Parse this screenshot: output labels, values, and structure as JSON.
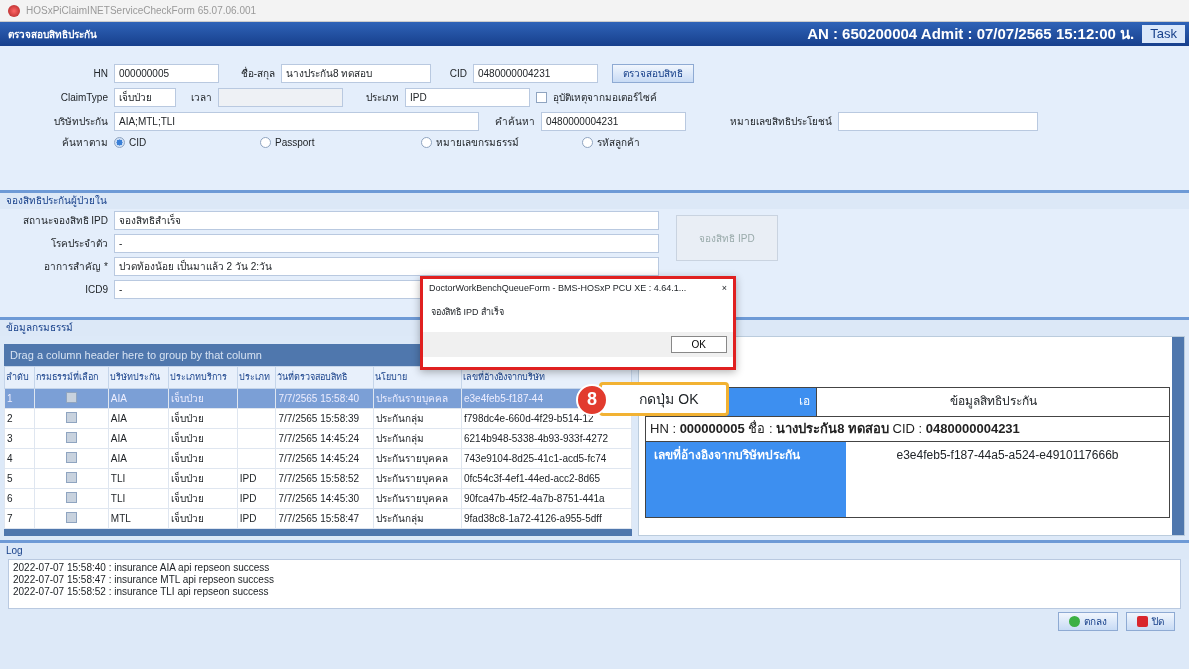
{
  "window": {
    "title": "HOSxPiClaimINETServiceCheckForm 65.07.06.001"
  },
  "header": {
    "title": "ตรวจสอบสิทธิประกัน",
    "admission": "AN : 650200004 Admit : 07/07/2565 15:12:00 น.",
    "task_button": "Task"
  },
  "form": {
    "hn": {
      "label": "HN",
      "value": "000000005"
    },
    "name": {
      "label": "ชื่อ-สกุล",
      "value": "นางประกัน8 ทดสอบ"
    },
    "cid": {
      "label": "CID",
      "value": "0480000004231"
    },
    "check_button": "ตรวจสอบสิทธิ",
    "claim_type": {
      "label": "ClaimType",
      "value": "เจ็บป่วย"
    },
    "time": {
      "label": "เวลา",
      "disabled": true
    },
    "type": {
      "label": "ประเภท",
      "value": "IPD"
    },
    "accident": {
      "label": "อุบัติเหตุจากมอเตอร์ไซค์",
      "checked": false
    },
    "company": {
      "label": "บริษัทประกัน",
      "value": "AIA;MTL;TLI"
    },
    "keyword": {
      "label": "คำค้นหา",
      "value": "0480000004231"
    },
    "benefit": {
      "label": "หมายเลขสิทธิประโยชน์"
    },
    "search_by": {
      "label": "ค้นหาตาม",
      "options": [
        {
          "label": "CID",
          "selected": true
        },
        {
          "label": "Passport",
          "selected": false
        },
        {
          "label": "หมายเลขกรมธรรม์",
          "selected": false
        },
        {
          "label": "รหัสลูกค้า",
          "selected": false
        }
      ]
    }
  },
  "ipd": {
    "title": "จองสิทธิประกันผู้ป่วยใน",
    "fields": [
      {
        "label": "สถานะจองสิทธิ IPD",
        "value": "จองสิทธิสำเร็จ"
      },
      {
        "label": "โรคประจำตัว",
        "value": "-"
      },
      {
        "label": "อาการสำคัญ *",
        "value": "ปวดท้องน้อย เป็นมาแล้ว 2 วัน 2:วัน"
      },
      {
        "label": "ICD9",
        "value": "-"
      }
    ],
    "button": {
      "label": "จองสิทธิ IPD",
      "disabled": true
    }
  },
  "policy": {
    "title": "ข้อมูลกรมธรรม์",
    "group_hint": "Drag a column header here to group by that column",
    "table": {
      "columns": [
        "ลำดับ",
        "กรมธรรม์ที่เลือก",
        "บริษัทประกัน",
        "ประเภทบริการ",
        "ประเภท",
        "วันที่ตรวจสอบสิทธิ",
        "นโยบาย",
        "เลขที่อ้างอิงจากบริษัท"
      ],
      "rows": [
        {
          "cells": [
            "1",
            "",
            "AIA",
            "เจ็บป่วย",
            "",
            "7/7/2565 15:58:40",
            "ประกันรายบุคคล",
            "e3e4feb5-f187-44"
          ],
          "selected": true
        },
        {
          "cells": [
            "2",
            "",
            "AIA",
            "เจ็บป่วย",
            "",
            "7/7/2565 15:58:39",
            "ประกันกลุ่ม",
            "f798dc4e-660d-4f29-b514-12"
          ],
          "selected": false
        },
        {
          "cells": [
            "3",
            "",
            "AIA",
            "เจ็บป่วย",
            "",
            "7/7/2565 14:45:24",
            "ประกันกลุ่ม",
            "6214b948-5338-4b93-933f-4272"
          ],
          "selected": false
        },
        {
          "cells": [
            "4",
            "",
            "AIA",
            "เจ็บป่วย",
            "",
            "7/7/2565 14:45:24",
            "ประกันรายบุคคล",
            "743e9104-8d25-41c1-acd5-fc74"
          ],
          "selected": false
        },
        {
          "cells": [
            "5",
            "",
            "TLI",
            "เจ็บป่วย",
            "IPD",
            "7/7/2565 15:58:52",
            "ประกันรายบุคคล",
            "0fc54c3f-4ef1-44ed-acc2-8d65"
          ],
          "selected": false
        },
        {
          "cells": [
            "6",
            "",
            "TLI",
            "เจ็บป่วย",
            "IPD",
            "7/7/2565 14:45:30",
            "ประกันรายบุคคล",
            "90fca47b-45f2-4a7b-8751-441a"
          ],
          "selected": false
        },
        {
          "cells": [
            "7",
            "",
            "MTL",
            "เจ็บป่วย",
            "IPD",
            "7/7/2565 15:58:47",
            "ประกันกลุ่ม",
            "9fad38c8-1a72-4126-a955-5dff"
          ],
          "selected": false
        }
      ]
    },
    "detail": {
      "headers": [
        "เอ",
        "ข้อมูลสิทธิประกัน"
      ],
      "info": "HN : **000000005** ชื่อ : **นางประกัน8 ทดสอบ** CID : **0480000004231**",
      "ref_label": "เลขที่อ้างอิงจากบริษัทประกัน",
      "ref_value": "e3e4feb5-f187-44a5-a524-e4910117666b"
    }
  },
  "log": {
    "title": "Log",
    "lines": [
      "2022-07-07 15:58:40 : insurance AIA api repseon success",
      "2022-07-07 15:58:47 : insurance MTL api repseon success",
      "2022-07-07 15:58:52 : insurance TLI api repseon success"
    ]
  },
  "footer": {
    "buttons": [
      {
        "label": "ตกลง",
        "kind": "ok"
      },
      {
        "label": "ปิด",
        "kind": "close"
      }
    ]
  },
  "dialog": {
    "title": "DoctorWorkBenchQueueForm - BMS-HOSxP PCU XE : 4.64.1...",
    "close": "×",
    "message": "จองสิทธิ IPD สำเร็จ",
    "ok": "OK"
  },
  "callout": {
    "step": "8",
    "text": "กดปุ่ม OK"
  }
}
